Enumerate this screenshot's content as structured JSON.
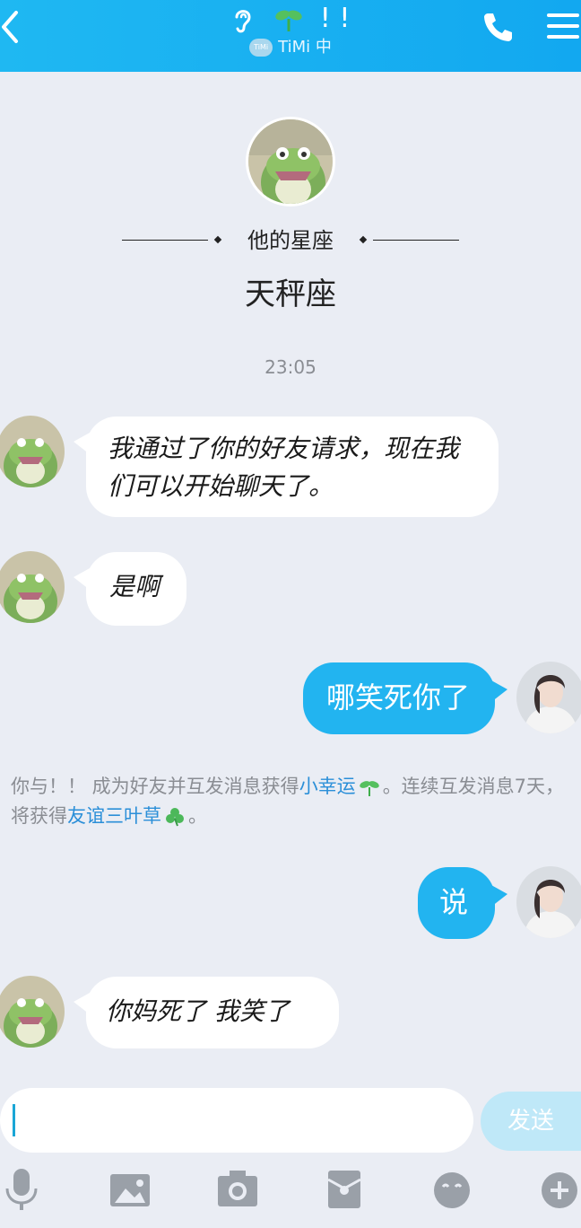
{
  "header": {
    "title_marks": "! !",
    "subtitle_badge": "TiMi",
    "subtitle": "TiMi 中",
    "bg_color": "#16aff1"
  },
  "profile": {
    "zodiac_label": "他的星座",
    "zodiac_value": "天秤座"
  },
  "timestamp": "23:05",
  "messages": [
    {
      "from": "friend",
      "text": "我通过了你的好友请求，现在我们可以开始聊天了。"
    },
    {
      "from": "friend",
      "text": "是啊"
    },
    {
      "from": "self",
      "text": "哪笑死你了"
    },
    {
      "from": "self",
      "text": "说"
    },
    {
      "from": "friend",
      "text": "你妈死了 我笑了"
    }
  ],
  "notice": {
    "part1": "你与！！ 成为好友并互发消息获得",
    "link1": "小幸运",
    "part2": "。连续互发消息7天，将获得",
    "link2": "友谊三叶草",
    "part3": "。"
  },
  "input": {
    "value": "",
    "send_label": "发送"
  },
  "toolbar": {
    "icons": [
      "microphone-icon",
      "image-icon",
      "camera-icon",
      "red-packet-icon",
      "emoji-icon",
      "plus-icon"
    ]
  },
  "colors": {
    "accent": "#22b4f0",
    "link": "#2b8fd8",
    "background": "#eaedf4"
  }
}
